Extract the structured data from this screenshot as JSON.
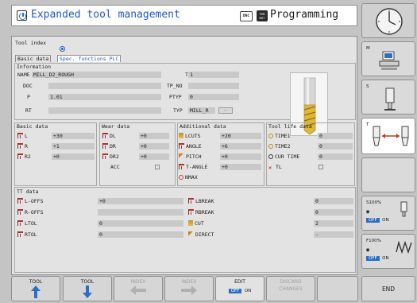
{
  "header": {
    "title": "Expanded tool management",
    "dnc_badge": "DNC",
    "pgm_badge": "PGM\nMGT",
    "mode_title": "Programming"
  },
  "tool_index": {
    "label": "Tool index"
  },
  "tabs": [
    {
      "label": "Basic data"
    },
    {
      "label": "Spec. functions PLC"
    }
  ],
  "information": {
    "title": "Information",
    "name_label": "NAME",
    "name_value": "MILL_D2_ROUGH",
    "doc_label": "DOC",
    "doc_value": "",
    "p_label": "P",
    "p_value": "1.01",
    "rt_label": "RT",
    "rt_value": "",
    "t_label": "T",
    "t_value": "1",
    "tp_no_label": "TP_NO",
    "tp_no_value": "",
    "ptyp_label": "PTYP",
    "ptyp_value": "0",
    "typ_label": "TYP",
    "typ_value": "MILL_R"
  },
  "basic_data": {
    "title": "Basic data",
    "rows": [
      {
        "label": "L",
        "value": "+30"
      },
      {
        "label": "R",
        "value": "+1"
      },
      {
        "label": "R2",
        "value": "+0"
      }
    ]
  },
  "wear_data": {
    "title": "Wear data",
    "rows": [
      {
        "label": "DL",
        "value": "+0"
      },
      {
        "label": "DR",
        "value": "+0"
      },
      {
        "label": "DR2",
        "value": "+0"
      },
      {
        "label": "ACC",
        "value": ""
      }
    ]
  },
  "additional_data": {
    "title": "Additional data",
    "rows": [
      {
        "label": "LCUTS",
        "value": "+20"
      },
      {
        "label": "ANGLE",
        "value": "+6"
      },
      {
        "label": "PITCH",
        "value": "+0"
      },
      {
        "label": "T-ANGLE",
        "value": "+0"
      },
      {
        "label": "NMAX",
        "value": ""
      }
    ]
  },
  "tool_life_data": {
    "title": "Tool life data",
    "rows": [
      {
        "label": "TIME1",
        "value": "0"
      },
      {
        "label": "TIME2",
        "value": "0"
      },
      {
        "label": "CUR TIME",
        "value": "0"
      },
      {
        "label": "TL",
        "value": ""
      }
    ]
  },
  "tt_data": {
    "title": "TT data",
    "left": [
      {
        "label": "L-OFFS",
        "value": "+0"
      },
      {
        "label": "R-OFFS",
        "value": ""
      },
      {
        "label": "LTOL",
        "value": "0"
      },
      {
        "label": "RTOL",
        "value": "0"
      }
    ],
    "right": [
      {
        "label": "LBREAK",
        "value": "0"
      },
      {
        "label": "RBREAK",
        "value": "0"
      },
      {
        "label": "CUT",
        "value": "2"
      },
      {
        "label": "DIRECT",
        "value": "-"
      }
    ]
  },
  "right_softkeys": [
    {
      "caption": ""
    },
    {
      "caption": "M"
    },
    {
      "caption": "S"
    },
    {
      "caption": "T"
    },
    {
      "caption": ""
    },
    {
      "caption": "S100%",
      "toggle_off": "OFF",
      "toggle_on": "ON"
    },
    {
      "caption": "F100%",
      "toggle_off": "OFF",
      "toggle_on": "ON"
    }
  ],
  "bottom_softkeys": [
    {
      "label": "TOOL",
      "enabled": true
    },
    {
      "label": "TOOL",
      "enabled": true
    },
    {
      "label": "INDEX",
      "enabled": false
    },
    {
      "label": "INDEX",
      "enabled": false
    },
    {
      "label": "EDIT",
      "toggle_off": "OFF",
      "toggle_on": "ON",
      "enabled": true
    },
    {
      "label": "DISCARD",
      "label2": "CHANGES",
      "enabled": false
    },
    {
      "label": "",
      "enabled": false
    },
    {
      "label": "END",
      "enabled": true
    }
  ],
  "colors": {
    "accent_blue": "#2155c7",
    "toggle_blue": "#2b6fc4",
    "tool_red": "#b23030"
  }
}
